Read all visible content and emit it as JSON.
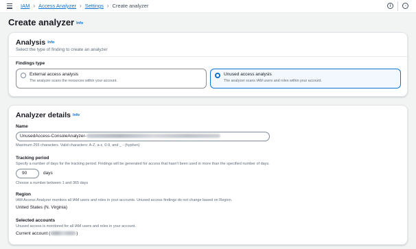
{
  "breadcrumb": {
    "items": [
      "IAM",
      "Access Analyzer",
      "Settings"
    ],
    "current": "Create analyzer"
  },
  "header": {
    "title": "Create analyzer",
    "info": "Info"
  },
  "analysis": {
    "title": "Analysis",
    "info": "Info",
    "description": "Select the type of finding to create an analyzer",
    "findings_type_label": "Findings type",
    "options": [
      {
        "title": "External access analysis",
        "description": "The analyzer scans the resources within your account.",
        "selected": false
      },
      {
        "title": "Unused access analysis",
        "description": "The analyzer scans IAM users and roles within your account.",
        "selected": true
      }
    ]
  },
  "details": {
    "title": "Analyzer details",
    "info": "Info",
    "name": {
      "label": "Name",
      "value": "UnusedAccess-ConsoleAnalyzer-",
      "hint": "Maximum 255 characters. Valid characters: A-Z, a-z, 0-9, and _ - (hyphen)"
    },
    "tracking": {
      "label": "Tracking period",
      "description": "Specify a number of days for the tracking period. Findings will be generated for access that hasn't been used in more than the specified number of days.",
      "value": "90",
      "unit": "days",
      "hint": "Choose a number between 1 and 365 days"
    },
    "region": {
      "label": "Region",
      "description": "IAM Access Analyzer monitors all IAM users and roles in your accounts. Unused access findings do not change based on Region.",
      "value": "United States (N. Virginia)"
    },
    "accounts": {
      "label": "Selected accounts",
      "description": "Unused access is monitored for all IAM users and roles in your account.",
      "value_prefix": "Current account (",
      "value_suffix": ")"
    }
  },
  "colors": {
    "link": "#0972d3",
    "selected_border": "#0972d3",
    "selected_bg": "#f2f8fd"
  },
  "icons": {
    "menu": "hamburger-icon",
    "info": "info-circle-icon",
    "notifications": "notification-icon"
  }
}
